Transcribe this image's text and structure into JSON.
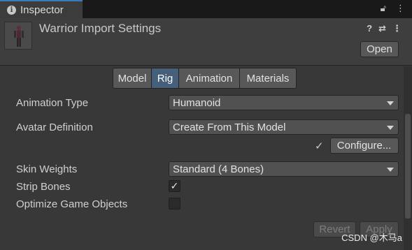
{
  "tab": {
    "title": "Inspector",
    "icon": "info-icon"
  },
  "tabbar_icons": [
    "lock-icon",
    "more-icon"
  ],
  "header": {
    "title": "Warrior Import Settings",
    "icons": [
      "help-icon",
      "settings-sliders-icon",
      "more-icon"
    ],
    "open_label": "Open"
  },
  "tabs": [
    {
      "label": "Model",
      "active": false
    },
    {
      "label": "Rig",
      "active": true
    },
    {
      "label": "Animation",
      "active": false
    },
    {
      "label": "Materials",
      "active": false
    }
  ],
  "fields": {
    "animation_type": {
      "label": "Animation Type",
      "value": "Humanoid"
    },
    "avatar_definition": {
      "label": "Avatar Definition",
      "value": "Create From This Model"
    },
    "configure_label": "Configure...",
    "skin_weights": {
      "label": "Skin Weights",
      "value": "Standard (4 Bones)"
    },
    "strip_bones": {
      "label": "Strip Bones",
      "checked": true
    },
    "optimize_game_objects": {
      "label": "Optimize Game Objects",
      "checked": false
    }
  },
  "footer": {
    "revert_label": "Revert",
    "apply_label": "Apply"
  },
  "watermark": "CSDN @木马a",
  "colors": {
    "active_tab": "#46607c",
    "tab_accent": "#3a79bb",
    "panel": "#383838"
  }
}
